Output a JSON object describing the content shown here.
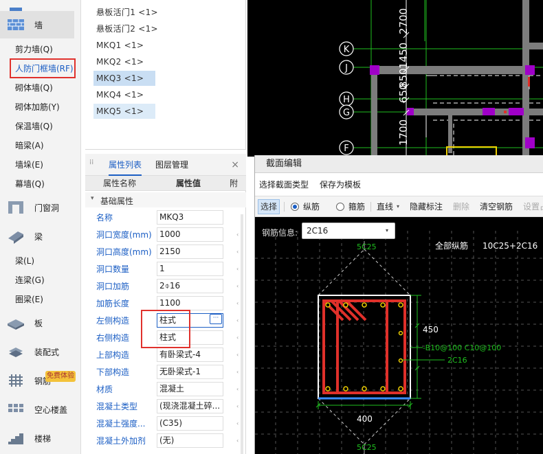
{
  "sidebar": {
    "wall_label": "墙",
    "door_window_label": "门窗洞",
    "beam_label": "梁",
    "slab_label": "板",
    "prefab_label": "装配式",
    "rebar_mesh_label": "钢筋",
    "hollow_slab_label": "空心楼盖",
    "stairs_label": "楼梯",
    "free_badge": "免费体验",
    "wall_items": [
      "剪力墙(Q)",
      "人防门框墙(RF)",
      "砌体墙(Q)",
      "砌体加筋(Y)",
      "保温墙(Q)",
      "暗梁(A)",
      "墙垛(E)",
      "幕墙(Q)"
    ],
    "beam_items": [
      "梁(L)",
      "连梁(G)",
      "圈梁(E)"
    ]
  },
  "list": {
    "items": [
      "悬板活门1 <1>",
      "悬板活门2 <1>",
      "MKQ1 <1>",
      "MKQ2 <1>",
      "MKQ3 <1>",
      "MKQ4 <1>",
      "MKQ5 <1>"
    ]
  },
  "props": {
    "tab_props": "属性列表",
    "tab_layers": "图层管理",
    "close": "×",
    "col_name": "属性名称",
    "col_value": "属性值",
    "col_extra": "附",
    "section": "基础属性",
    "rows": [
      {
        "name": "名称",
        "value": "MKQ3"
      },
      {
        "name": "洞口宽度(mm)",
        "value": "1000"
      },
      {
        "name": "洞口高度(mm)",
        "value": "2150"
      },
      {
        "name": "洞口数量",
        "value": "1"
      },
      {
        "name": "洞口加筋",
        "value": "2⌽16"
      },
      {
        "name": "加筋长度",
        "value": "1100"
      },
      {
        "name": "左侧构造",
        "value": "柱式"
      },
      {
        "name": "右侧构造",
        "value": "柱式"
      },
      {
        "name": "上部构造",
        "value": "有卧梁式-4"
      },
      {
        "name": "下部构造",
        "value": "无卧梁式-1"
      },
      {
        "name": "材质",
        "value": "混凝土"
      },
      {
        "name": "混凝土类型",
        "value": "(现浇混凝土碎..."
      },
      {
        "name": "混凝土强度...",
        "value": "(C35)"
      },
      {
        "name": "混凝土外加剂",
        "value": "(无)"
      }
    ],
    "dots": "···"
  },
  "cad": {
    "axes": [
      "K",
      "J",
      "H",
      "G",
      "F"
    ],
    "dims": [
      "2700",
      "1450",
      "850",
      "650",
      "1700"
    ]
  },
  "dialog": {
    "title": "截面编辑",
    "menu_section_type": "选择截面类型",
    "menu_save_template": "保存为模板",
    "tool_select": "选择",
    "tool_longitudinal": "纵筋",
    "tool_stirrup": "箍筋",
    "tool_line": "直线",
    "tool_hide_dim": "隐藏标注",
    "tool_delete": "删除",
    "tool_clear": "清空钢筋",
    "tool_set": "设置占",
    "rebar_info_label": "钢筋信息:",
    "rebar_info_value": "2C16",
    "all_longitudinal": "全部纵筋",
    "all_longitudinal_value": "10C25+2C16",
    "top_rebar": "5C25",
    "bottom_rebar": "5C25",
    "height_dim": "450",
    "width_dim": "400",
    "stirrup_note": "-B10@100 C10@100",
    "side_note": "2C16"
  },
  "colors": {
    "accent": "#1b5ec4",
    "highlight_red": "#e0312c",
    "rebar_red": "#e0302a",
    "cad_green": "#1fbf1f",
    "cad_magenta": "#a000c8"
  }
}
